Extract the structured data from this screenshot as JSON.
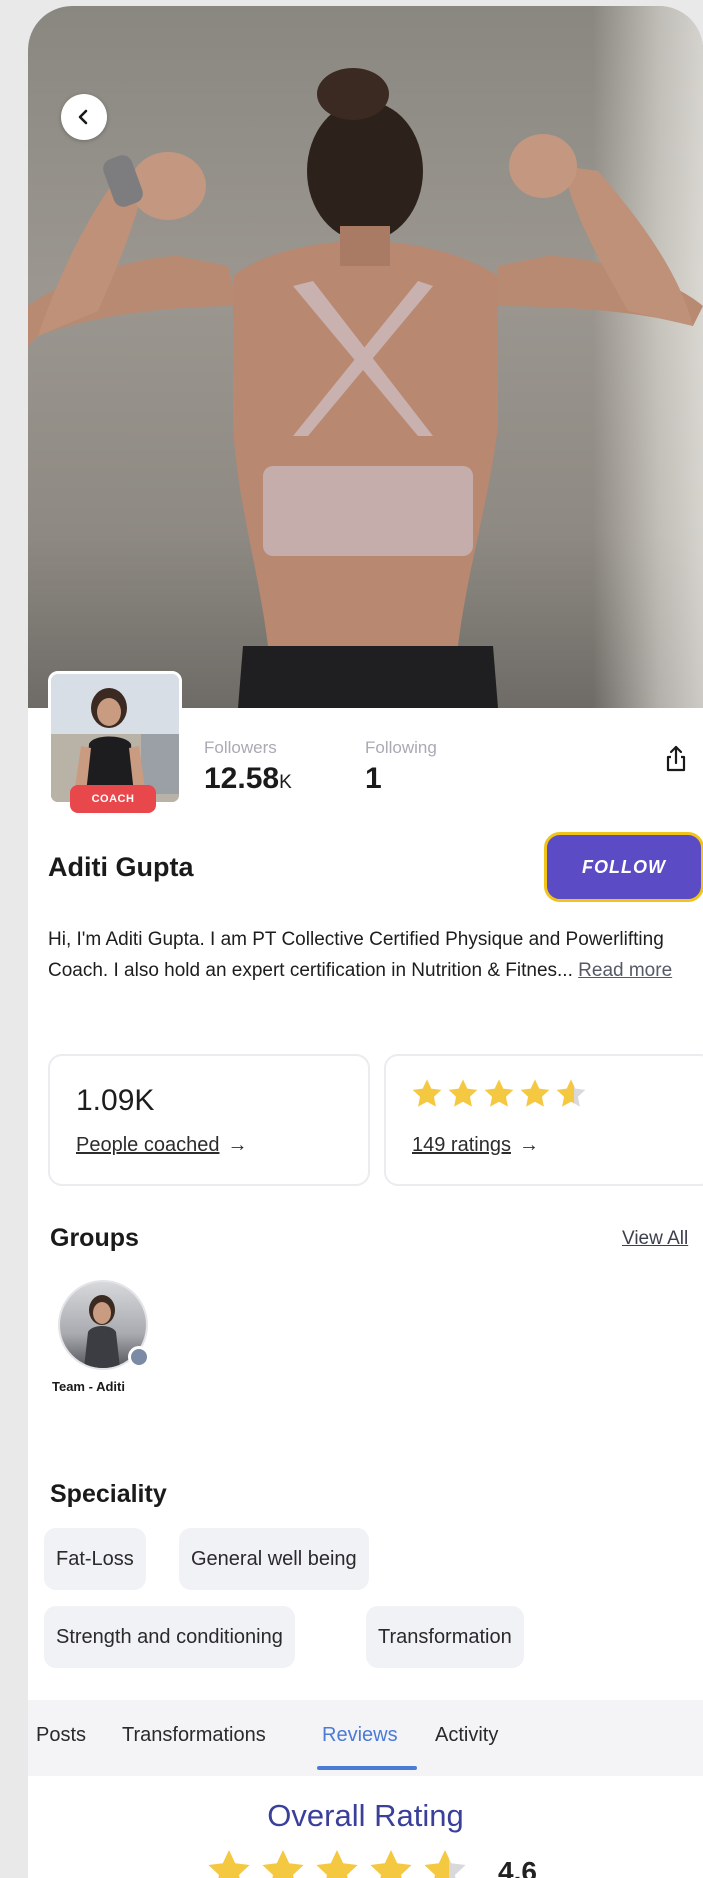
{
  "profile": {
    "role_badge": "COACH",
    "name": "Aditi Gupta",
    "followers_label": "Followers",
    "followers_value": "12.58",
    "followers_unit": "K",
    "following_label": "Following",
    "following_value": "1",
    "follow_button": "FOLLOW",
    "bio": "Hi, I'm Aditi Gupta. I am PT Collective Certified Physique and Powerlifting Coach. I also hold an expert certification in Nutrition & Fitnes...",
    "read_more": "Read more"
  },
  "cards": {
    "coached_value": "1.09K",
    "coached_link": "People coached",
    "ratings_link": "149 ratings",
    "ratings_stars": 4.6
  },
  "groups": {
    "title": "Groups",
    "view_all": "View All",
    "items": [
      {
        "name": "Team - Aditi"
      }
    ]
  },
  "speciality": {
    "title": "Speciality",
    "chips": [
      "Fat-Loss",
      "General well being",
      "Strength and conditioning",
      "Transformation"
    ]
  },
  "tabs": {
    "items": [
      "Posts",
      "Transformations",
      "Reviews",
      "Activity"
    ],
    "active": "Reviews"
  },
  "reviews": {
    "overall_title": "Overall Rating",
    "overall_value": "4.6",
    "overall_stars": 4.6
  },
  "colors": {
    "accent": "#5b4bc4",
    "follow_border": "#f0c419",
    "coach_badge": "#e8474c",
    "star": "#f5c842",
    "tab_active": "#4a7bd6"
  },
  "icons": {
    "back": "chevron-left-icon",
    "share": "share-icon",
    "arrow": "arrow-right-icon"
  }
}
